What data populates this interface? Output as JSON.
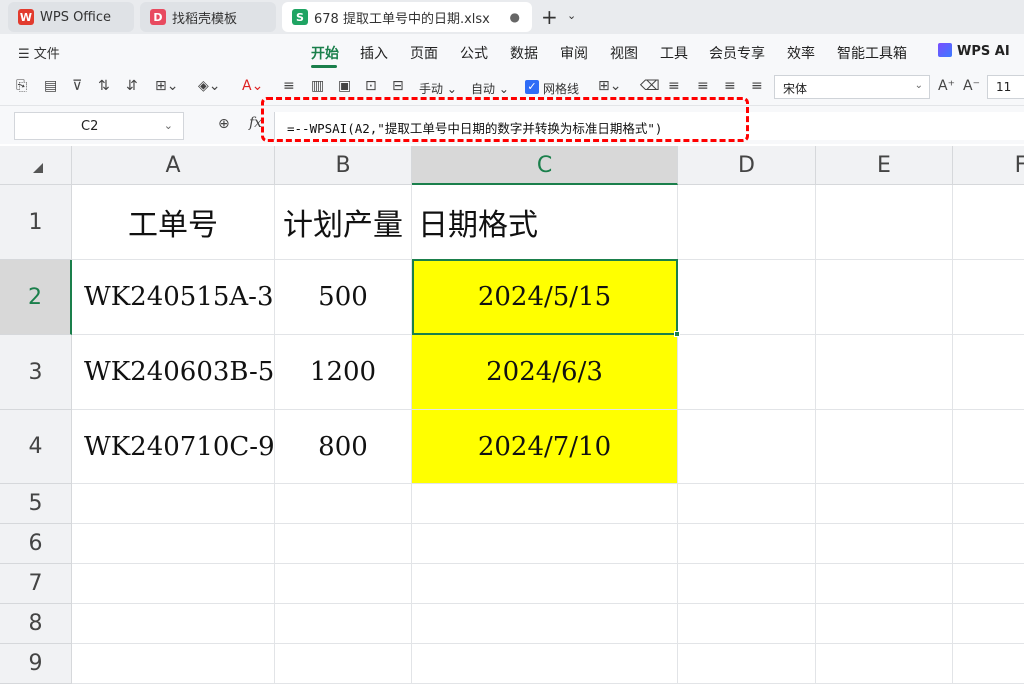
{
  "tabs": [
    {
      "label": "WPS Office",
      "icon": "wps-logo-icon"
    },
    {
      "label": "找稻壳模板",
      "icon": "docer-icon"
    },
    {
      "label": "678 提取工单号中的日期.xlsx",
      "icon": "spreadsheet-icon"
    }
  ],
  "file_menu": "文件",
  "menu": [
    "开始",
    "插入",
    "页面",
    "公式",
    "数据",
    "审阅",
    "视图",
    "工具",
    "会员专享",
    "效率",
    "智能工具箱"
  ],
  "active_menu": "开始",
  "wps_ai": "WPS AI",
  "toolbar": {
    "manual": "手动",
    "auto": "自动",
    "gridlines": "网格线",
    "gridlines_checked": true,
    "font_name": "宋体",
    "font_size": "11"
  },
  "name_box": "C2",
  "formula": "=--WPSAI(A2,\"提取工单号中日期的数字并转换为标准日期格式\")",
  "columns": [
    "A",
    "B",
    "C",
    "D",
    "E",
    "F"
  ],
  "rows": [
    "1",
    "2",
    "3",
    "4",
    "5",
    "6",
    "7",
    "8",
    "9"
  ],
  "header_row": [
    "工单号",
    "计划产量",
    "日期格式"
  ],
  "data_rows": [
    [
      "WK240515A-3",
      "500",
      "2024/5/15"
    ],
    [
      "WK240603B-5",
      "1200",
      "2024/6/3"
    ],
    [
      "WK240710C-9",
      "800",
      "2024/7/10"
    ]
  ],
  "selected_cell": "C2",
  "colors": {
    "accent": "#1a7f4b",
    "highlight": "#ffff00",
    "callout": "#ff0000"
  }
}
